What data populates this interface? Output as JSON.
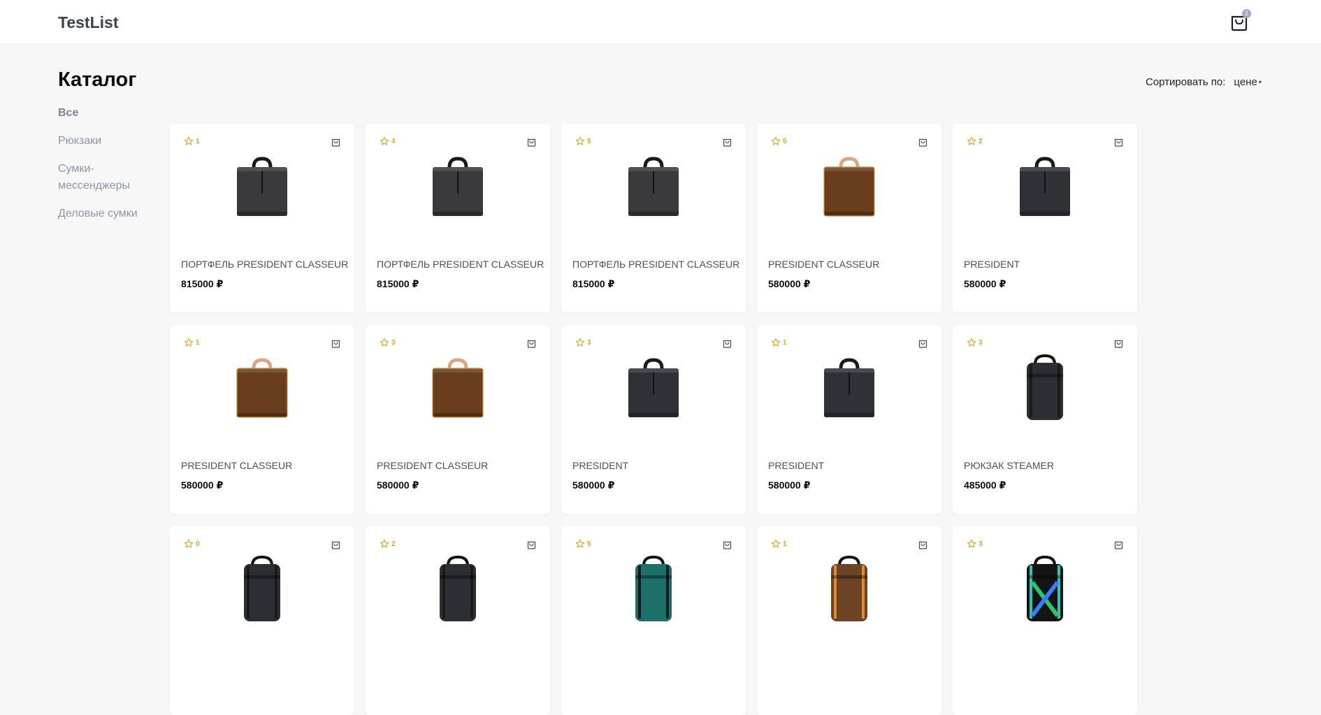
{
  "header": {
    "logo": "TestList",
    "cart_count": "2"
  },
  "page": {
    "title": "Каталог"
  },
  "sort": {
    "label": "Сортировать по:",
    "value": "цене"
  },
  "categories": [
    {
      "label": "Все",
      "active": true
    },
    {
      "label": "Рюкзаки"
    },
    {
      "label": "Сумки-мессенджеры"
    },
    {
      "label": "Деловые сумки"
    }
  ],
  "products": [
    {
      "rating": "1",
      "name": "ПОРТФЕЛЬ PRESIDENT CLASSEUR",
      "price": "815000 ₽",
      "image": "case-black"
    },
    {
      "rating": "4",
      "name": "ПОРТФЕЛЬ PRESIDENT CLASSEUR",
      "price": "815000 ₽",
      "image": "case-black"
    },
    {
      "rating": "5",
      "name": "ПОРТФЕЛЬ PRESIDENT CLASSEUR",
      "price": "815000 ₽",
      "image": "case-black"
    },
    {
      "rating": "5",
      "name": "PRESIDENT CLASSEUR",
      "price": "580000 ₽",
      "image": "case-brown"
    },
    {
      "rating": "2",
      "name": "PRESIDENT",
      "price": "580000 ₽",
      "image": "case-damier"
    },
    {
      "rating": "1",
      "name": "PRESIDENT CLASSEUR",
      "price": "580000 ₽",
      "image": "case-brown"
    },
    {
      "rating": "3",
      "name": "PRESIDENT CLASSEUR",
      "price": "580000 ₽",
      "image": "case-brown"
    },
    {
      "rating": "3",
      "name": "PRESIDENT",
      "price": "580000 ₽",
      "image": "case-damier"
    },
    {
      "rating": "1",
      "name": "PRESIDENT",
      "price": "580000 ₽",
      "image": "case-damier"
    },
    {
      "rating": "3",
      "name": "РЮКЗАК STEAMER",
      "price": "485000 ₽",
      "image": "backpack-dark"
    },
    {
      "rating": "0",
      "name": "",
      "price": "",
      "image": "backpack-dark"
    },
    {
      "rating": "2",
      "name": "",
      "price": "",
      "image": "backpack-dark"
    },
    {
      "rating": "5",
      "name": "",
      "price": "",
      "image": "backpack-teal"
    },
    {
      "rating": "1",
      "name": "",
      "price": "",
      "image": "backpack-orange"
    },
    {
      "rating": "3",
      "name": "",
      "price": "",
      "image": "backpack-rainbow"
    }
  ],
  "colors": {
    "accent_star": "#d4a72c",
    "muted_text": "#8c95a8",
    "badge": "#9fa9c4"
  }
}
